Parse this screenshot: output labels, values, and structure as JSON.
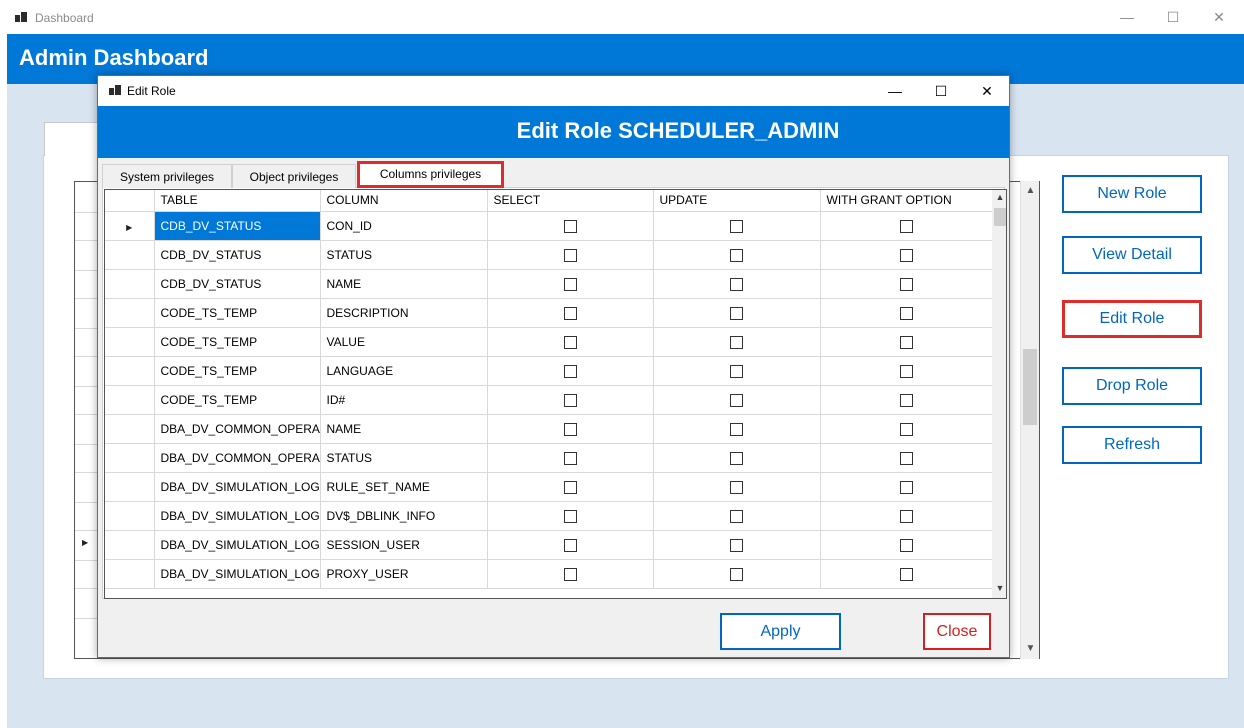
{
  "window": {
    "title": "Dashboard",
    "controls": {
      "minimize": "—",
      "maximize": "☐",
      "close": "✕"
    }
  },
  "header": {
    "title": "Admin Dashboard"
  },
  "sidebar_buttons": [
    {
      "label": "New Role"
    },
    {
      "label": "View Detail"
    },
    {
      "label": "Edit Role"
    },
    {
      "label": "Drop Role"
    },
    {
      "label": "Refresh"
    }
  ],
  "dialog": {
    "title": "Edit Role",
    "heading": "Edit Role SCHEDULER_ADMIN",
    "controls": {
      "minimize": "—",
      "maximize": "☐",
      "close": "✕"
    },
    "tabs": [
      {
        "label": "System privileges"
      },
      {
        "label": "Object privileges"
      },
      {
        "label": "Columns privileges",
        "active": true
      }
    ],
    "grid": {
      "columns": [
        "TABLE",
        "COLUMN",
        "SELECT",
        "UPDATE",
        "WITH GRANT OPTION"
      ],
      "rows": [
        {
          "table": "CDB_DV_STATUS",
          "column": "CON_ID",
          "select": false,
          "update": false,
          "grant": false,
          "current": true
        },
        {
          "table": "CDB_DV_STATUS",
          "column": "STATUS",
          "select": false,
          "update": false,
          "grant": false
        },
        {
          "table": "CDB_DV_STATUS",
          "column": "NAME",
          "select": false,
          "update": false,
          "grant": false
        },
        {
          "table": "CODE_TS_TEMP",
          "column": "DESCRIPTION",
          "select": false,
          "update": false,
          "grant": false
        },
        {
          "table": "CODE_TS_TEMP",
          "column": "VALUE",
          "select": false,
          "update": false,
          "grant": false
        },
        {
          "table": "CODE_TS_TEMP",
          "column": "LANGUAGE",
          "select": false,
          "update": false,
          "grant": false
        },
        {
          "table": "CODE_TS_TEMP",
          "column": "ID#",
          "select": false,
          "update": false,
          "grant": false
        },
        {
          "table": "DBA_DV_COMMON_OPERA...",
          "column": "NAME",
          "select": false,
          "update": false,
          "grant": false
        },
        {
          "table": "DBA_DV_COMMON_OPERA...",
          "column": "STATUS",
          "select": false,
          "update": false,
          "grant": false
        },
        {
          "table": "DBA_DV_SIMULATION_LOG",
          "column": "RULE_SET_NAME",
          "select": false,
          "update": false,
          "grant": false
        },
        {
          "table": "DBA_DV_SIMULATION_LOG",
          "column": "DV$_DBLINK_INFO",
          "select": false,
          "update": false,
          "grant": false
        },
        {
          "table": "DBA_DV_SIMULATION_LOG",
          "column": "SESSION_USER",
          "select": false,
          "update": false,
          "grant": false
        },
        {
          "table": "DBA_DV_SIMULATION_LOG",
          "column": "PROXY_USER",
          "select": false,
          "update": false,
          "grant": false
        }
      ]
    },
    "buttons": {
      "apply": "Apply",
      "close": "Close"
    }
  },
  "icons": {
    "row_indicator": "▶",
    "scroll_up": "▲",
    "scroll_down": "▼"
  },
  "colors": {
    "accent": "#0078d7",
    "button_border": "#0067c0",
    "highlight_red": "#e02b2b"
  }
}
